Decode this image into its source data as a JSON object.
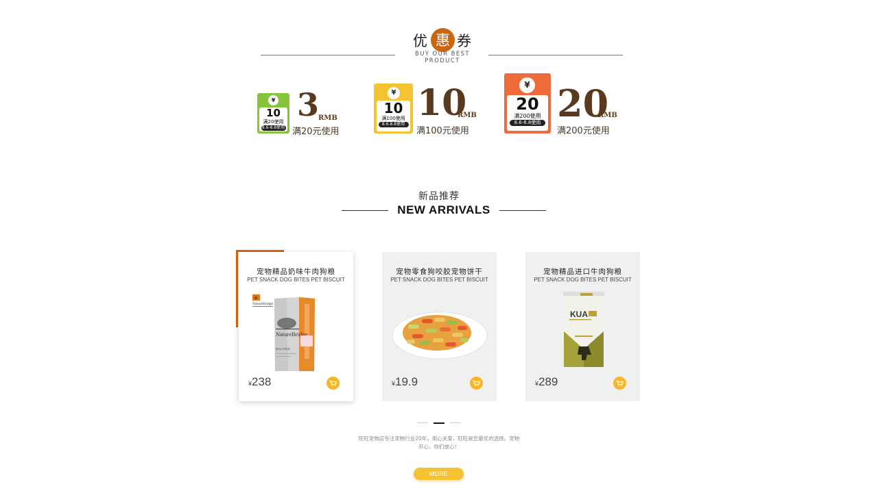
{
  "coupon_section": {
    "title_1": "优",
    "title_2": "惠",
    "title_3": "券",
    "subtitle": "BUY OUR BEST PRODUCT",
    "coupons": [
      {
        "yen": "¥",
        "tag_value": "10",
        "tag_condition": "满20使用",
        "date": "8.6-8.8使用",
        "amount": "3",
        "unit": "RMB",
        "description": "满20元使用",
        "color": "#86c43e"
      },
      {
        "yen": "¥",
        "tag_value": "10",
        "tag_condition": "满100使用",
        "date": "8.6-8.8使用",
        "amount": "10",
        "unit": "RMB",
        "description": "满100元使用",
        "color": "#f5c230"
      },
      {
        "yen": "¥",
        "tag_value": "20",
        "tag_condition": "满200使用",
        "date": "8.6-8.8使用",
        "amount": "20",
        "unit": "RMB",
        "description": "满200元使用",
        "color": "#ef6c3a"
      }
    ]
  },
  "arrivals": {
    "title_cn": "新品推荐",
    "title_en": "NEW ARRIVALS",
    "products": [
      {
        "name": "宠物精品奶味牛肉狗粮",
        "subtitle": "PET SNACK DOG BITES PET BISCUIT",
        "currency": "¥",
        "price": "238",
        "brand": "NatureBridge",
        "brand_small": "NatureBridge",
        "variant": "BALANCE",
        "image": "dog-food-bag"
      },
      {
        "name": "宠物零食狗咬胶宠物饼干",
        "subtitle": "PET SNACK DOG BITES PET BISCUIT",
        "currency": "¥",
        "price": "19.9",
        "image": "biscuit-plate"
      },
      {
        "name": "宠物精品进口牛肉狗粮",
        "subtitle": "PET SNACK DOG BITES PET BISCUIT",
        "currency": "¥",
        "price": "289",
        "brand": "KUA",
        "image": "imported-dog-food-bag"
      }
    ]
  },
  "footer": {
    "text": "旺旺宠物店专注宠物行业20年，用心关爱，旺旺是您最优的选择。宠物开心，你们放心！",
    "more_label": "MORE"
  },
  "colors": {
    "accent_orange": "#d9650f",
    "cart_yellow": "#f5b629",
    "more_yellow": "#f5c230",
    "card_bg": "#f0f0f0"
  }
}
